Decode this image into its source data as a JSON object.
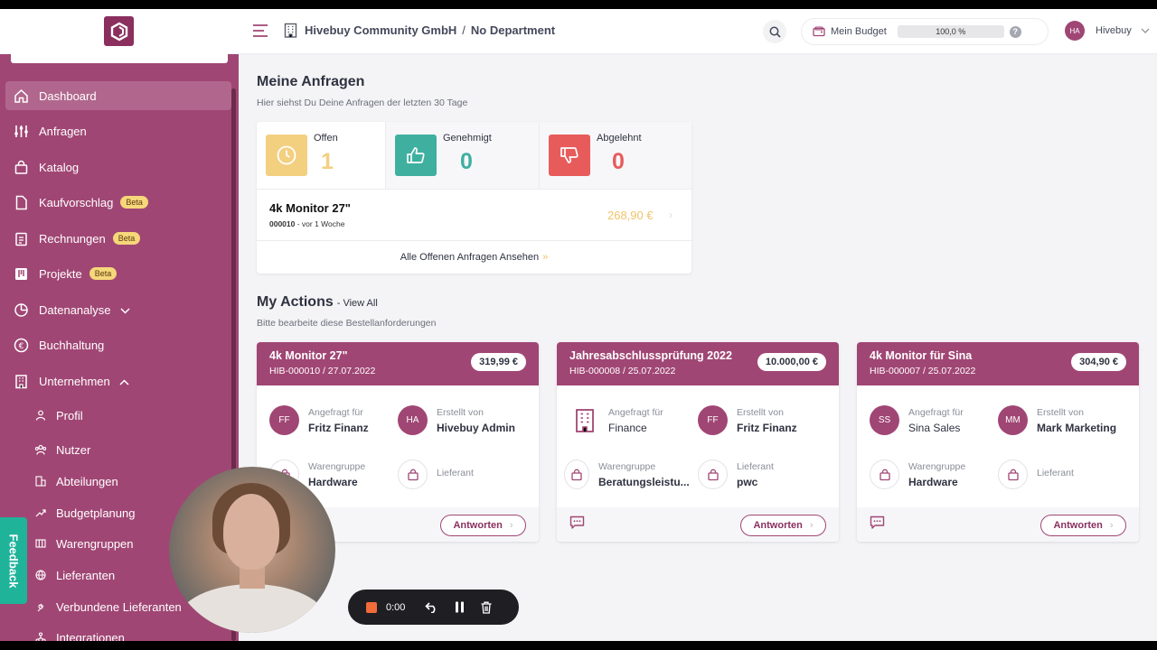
{
  "sidebar": {
    "items": [
      {
        "label": "Dashboard",
        "icon": "home-icon"
      },
      {
        "label": "Anfragen",
        "icon": "sliders-icon"
      },
      {
        "label": "Katalog",
        "icon": "bag-icon"
      },
      {
        "label": "Kaufvorschlag",
        "icon": "file-icon",
        "badge": "Beta"
      },
      {
        "label": "Rechnungen",
        "icon": "clipboard-icon",
        "badge": "Beta"
      },
      {
        "label": "Projekte",
        "icon": "kanban-icon",
        "badge": "Beta"
      },
      {
        "label": "Datenanalyse",
        "icon": "pie-icon"
      },
      {
        "label": "Buchhaltung",
        "icon": "euro-icon"
      },
      {
        "label": "Unternehmen",
        "icon": "building-icon"
      }
    ],
    "sub_items": [
      {
        "label": "Profil",
        "icon": "person-icon"
      },
      {
        "label": "Nutzer",
        "icon": "users-icon"
      },
      {
        "label": "Abteilungen",
        "icon": "department-icon"
      },
      {
        "label": "Budgetplanung",
        "icon": "trend-icon"
      },
      {
        "label": "Warengruppen",
        "icon": "columns-icon"
      },
      {
        "label": "Lieferanten",
        "icon": "globe-icon"
      },
      {
        "label": "Verbundene Lieferanten",
        "icon": "plug-icon"
      },
      {
        "label": "Integrationen",
        "icon": "network-icon"
      }
    ],
    "feedback": "Feedback"
  },
  "header": {
    "company": "Hivebuy Community GmbH",
    "separator": "/",
    "department": "No Department",
    "budget_label": "Mein Budget",
    "budget_value": "100,0 %",
    "help": "?",
    "user_initials": "HA",
    "user_name": "Hivebuy"
  },
  "requests": {
    "title": "Meine Anfragen",
    "subtitle": "Hier siehst Du Deine Anfragen der letzten 30 Tage",
    "stats": [
      {
        "label": "Offen",
        "value": "1",
        "color": "#f0c36b"
      },
      {
        "label": "Genehmigt",
        "value": "0",
        "color": "#3fb0a0"
      },
      {
        "label": "Abgelehnt",
        "value": "0",
        "color": "#e85b5b"
      }
    ],
    "row": {
      "title": "4k Monitor 27\"",
      "id": "000010",
      "time": " - vor 1 Woche",
      "amount": "268,90 €"
    },
    "link": "Alle Offenen Anfragen Ansehen"
  },
  "actions": {
    "title": "My Actions",
    "view_all": "- View All",
    "subtitle": "Bitte bearbeite diese Bestellanforderungen",
    "cards": [
      {
        "title": "4k Monitor 27\"",
        "id": "HIB-000010 / 27.07.2022",
        "price": "319,99 €",
        "for_label": "Angefragt für",
        "for_value": "Fritz Finanz",
        "for_initials": "FF",
        "by_label": "Erstellt von",
        "by_value": "Hivebuy Admin",
        "by_initials": "HA",
        "group_label": "Warengruppe",
        "group_value": "Hardware",
        "supplier_label": "Lieferant",
        "supplier_value": "",
        "reply": "Antworten"
      },
      {
        "title": "Jahresabschlussprüfung 2022",
        "id": "HIB-000008 / 25.07.2022",
        "price": "10.000,00 €",
        "for_label": "Angefragt für",
        "for_value": "Finance",
        "for_initials": "",
        "by_label": "Erstellt von",
        "by_value": "Fritz Finanz",
        "by_initials": "FF",
        "group_label": "Warengruppe",
        "group_value": "Beratungsleistu...",
        "supplier_label": "Lieferant",
        "supplier_value": "pwc",
        "reply": "Antworten"
      },
      {
        "title": "4k Monitor für Sina",
        "id": "HIB-000007 / 25.07.2022",
        "price": "304,90 €",
        "for_label": "Angefragt für",
        "for_value": "Sina Sales",
        "for_initials": "SS",
        "by_label": "Erstellt von",
        "by_value": "Mark Marketing",
        "by_initials": "MM",
        "group_label": "Warengruppe",
        "group_value": "Hardware",
        "supplier_label": "Lieferant",
        "supplier_value": "",
        "reply": "Antworten"
      }
    ]
  },
  "recorder": {
    "time": "0:00"
  },
  "colors": {
    "brand": "#a04674",
    "accent_yellow": "#f0c36b",
    "accent_teal": "#3fb0a0",
    "accent_red": "#e85b5b"
  }
}
